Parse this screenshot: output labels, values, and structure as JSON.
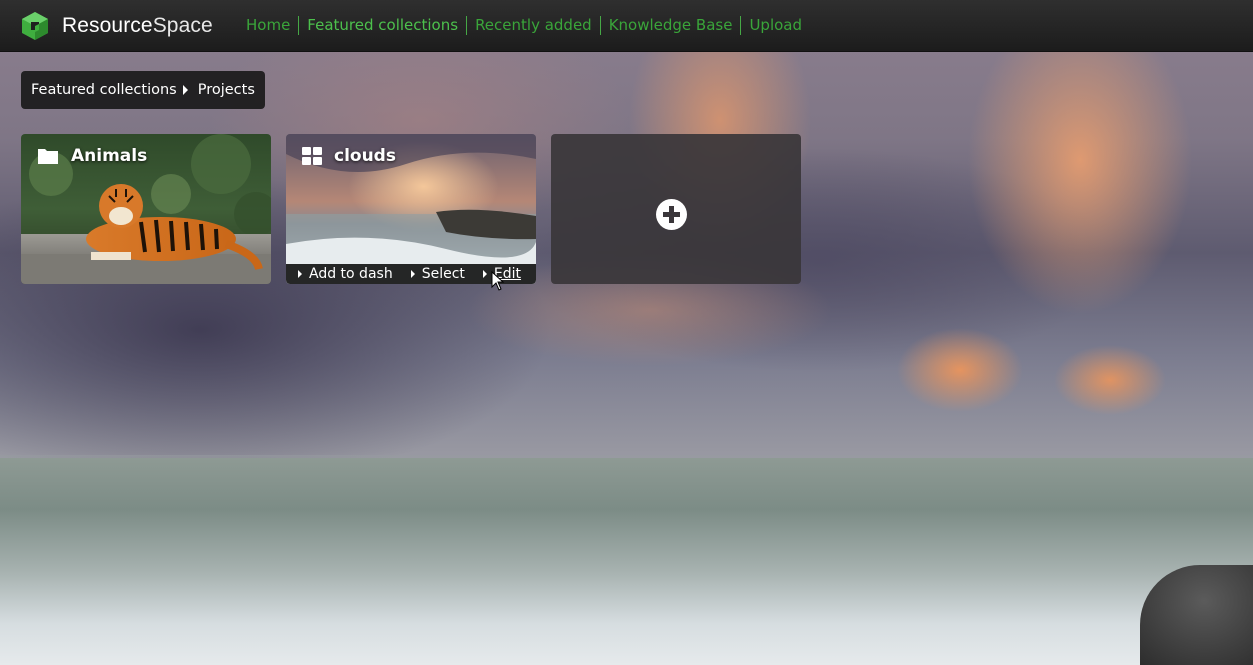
{
  "app": {
    "name_bold": "Resource",
    "name_light": "Space",
    "logo_color": "#3fae3f"
  },
  "nav": {
    "items": [
      {
        "label": "Home",
        "active": false
      },
      {
        "label": "Featured collections",
        "active": true
      },
      {
        "label": "Recently added",
        "active": false
      },
      {
        "label": "Knowledge Base",
        "active": false
      },
      {
        "label": "Upload",
        "active": false
      }
    ],
    "color": "#3aa53a"
  },
  "breadcrumb": {
    "items": [
      "Featured collections",
      "Projects"
    ]
  },
  "tiles": [
    {
      "title": "Animals",
      "icon": "folder-icon",
      "type": "category"
    },
    {
      "title": "clouds",
      "icon": "grid-icon",
      "type": "collection",
      "actions": [
        "Add to dash",
        "Select",
        "Edit"
      ]
    },
    {
      "title": "",
      "icon": "plus-circle-icon",
      "type": "add-new"
    }
  ]
}
